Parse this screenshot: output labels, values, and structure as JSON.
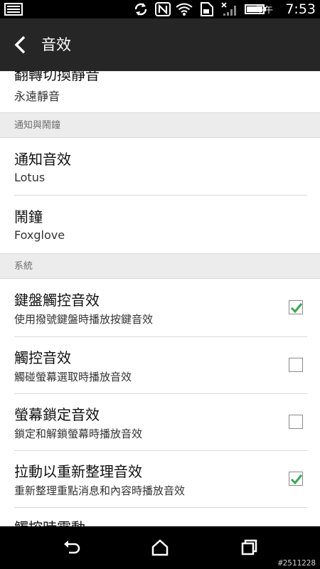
{
  "status_bar": {
    "ampm": "下午",
    "time": "7:53",
    "icons": [
      "image-notification-icon",
      "sync-icon",
      "nfc-icon",
      "wifi-icon",
      "sim-card-icon",
      "signal-icon",
      "battery-icon"
    ]
  },
  "action_bar": {
    "back_icon": "chevron-left-icon",
    "title": "音效"
  },
  "partial_top_item": {
    "title": "翻轉切換靜音",
    "summary": "永遠靜音"
  },
  "sections": [
    {
      "header": "通知與鬧鐘",
      "items": [
        {
          "title": "通知音效",
          "summary": "Lotus"
        },
        {
          "title": "鬧鐘",
          "summary": "Foxglove"
        }
      ]
    },
    {
      "header": "系統",
      "items": [
        {
          "title": "鍵盤觸控音效",
          "summary": "使用撥號鍵盤時播放按鍵音效",
          "checked": true
        },
        {
          "title": "觸控音效",
          "summary": "觸碰螢幕選取時播放音效",
          "checked": false
        },
        {
          "title": "螢幕鎖定音效",
          "summary": "鎖定和解鎖螢幕時播放音效",
          "checked": false
        },
        {
          "title": "拉動以重新整理音效",
          "summary": "重新整理重點消息和內容時播放音效",
          "checked": true
        }
      ]
    }
  ],
  "partial_bottom_item": {
    "title": "觸控時震動"
  },
  "nav_bar": {
    "icons": [
      "back-arrow-icon",
      "home-icon",
      "recent-apps-icon"
    ]
  },
  "watermark": "#2511228",
  "colors": {
    "status_bar": "#000000",
    "action_bar": "#262626",
    "section_header": "#ececec",
    "checkbox_check": "#3aa757"
  }
}
